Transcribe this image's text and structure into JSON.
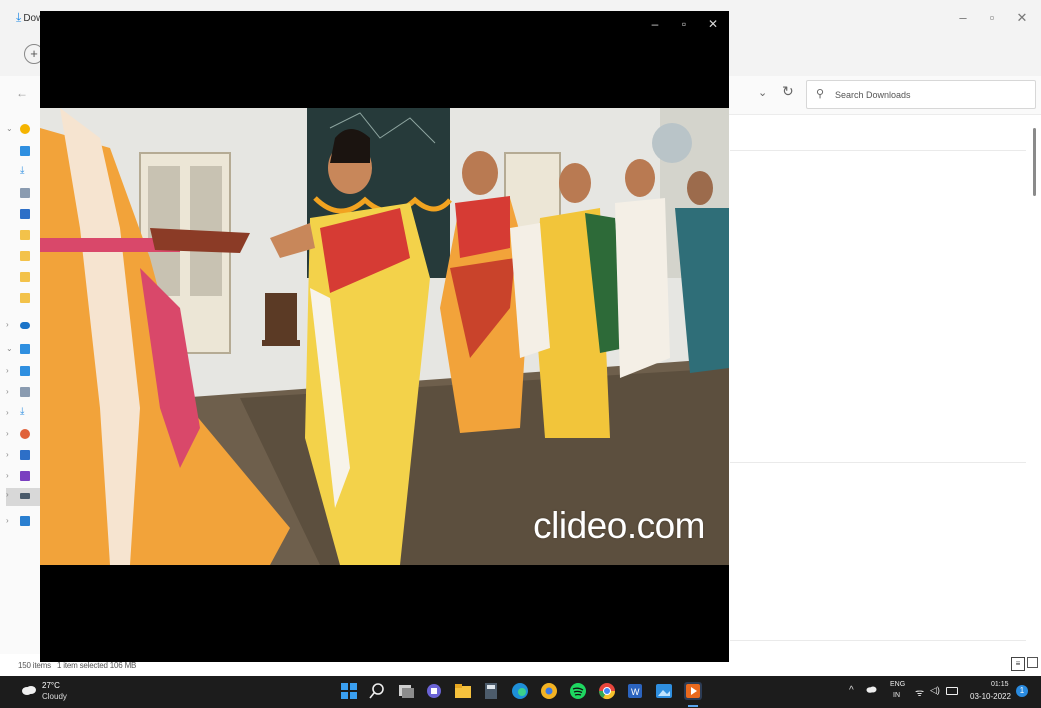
{
  "explorer": {
    "title_fragment": "Dow",
    "search_placeholder": "Search Downloads",
    "status": {
      "items": "150 items",
      "selected": "1 item selected  106 MB"
    }
  },
  "player": {
    "watermark": "clideo.com"
  },
  "taskbar": {
    "weather": {
      "temperature": "27°C",
      "condition": "Cloudy"
    },
    "language": {
      "top": "ENG",
      "bottom": "IN"
    },
    "clock": {
      "time": "01:15",
      "date": "03-10-2022"
    },
    "notification_count": "1"
  },
  "colors": {
    "taskbar_bg": "#1c1c1c",
    "accent": "#2a8be0",
    "player_bg": "#000000",
    "explorer_bg": "#ffffff"
  },
  "icons": {
    "taskbar_apps": [
      "windows-start-icon",
      "search-icon",
      "task-view-icon",
      "teams-chat-icon",
      "file-explorer-icon",
      "calculator-icon",
      "edge-icon",
      "chrome-canary-icon",
      "spotify-icon",
      "chrome-icon",
      "word-icon",
      "photos-icon",
      "media-player-icon"
    ]
  }
}
